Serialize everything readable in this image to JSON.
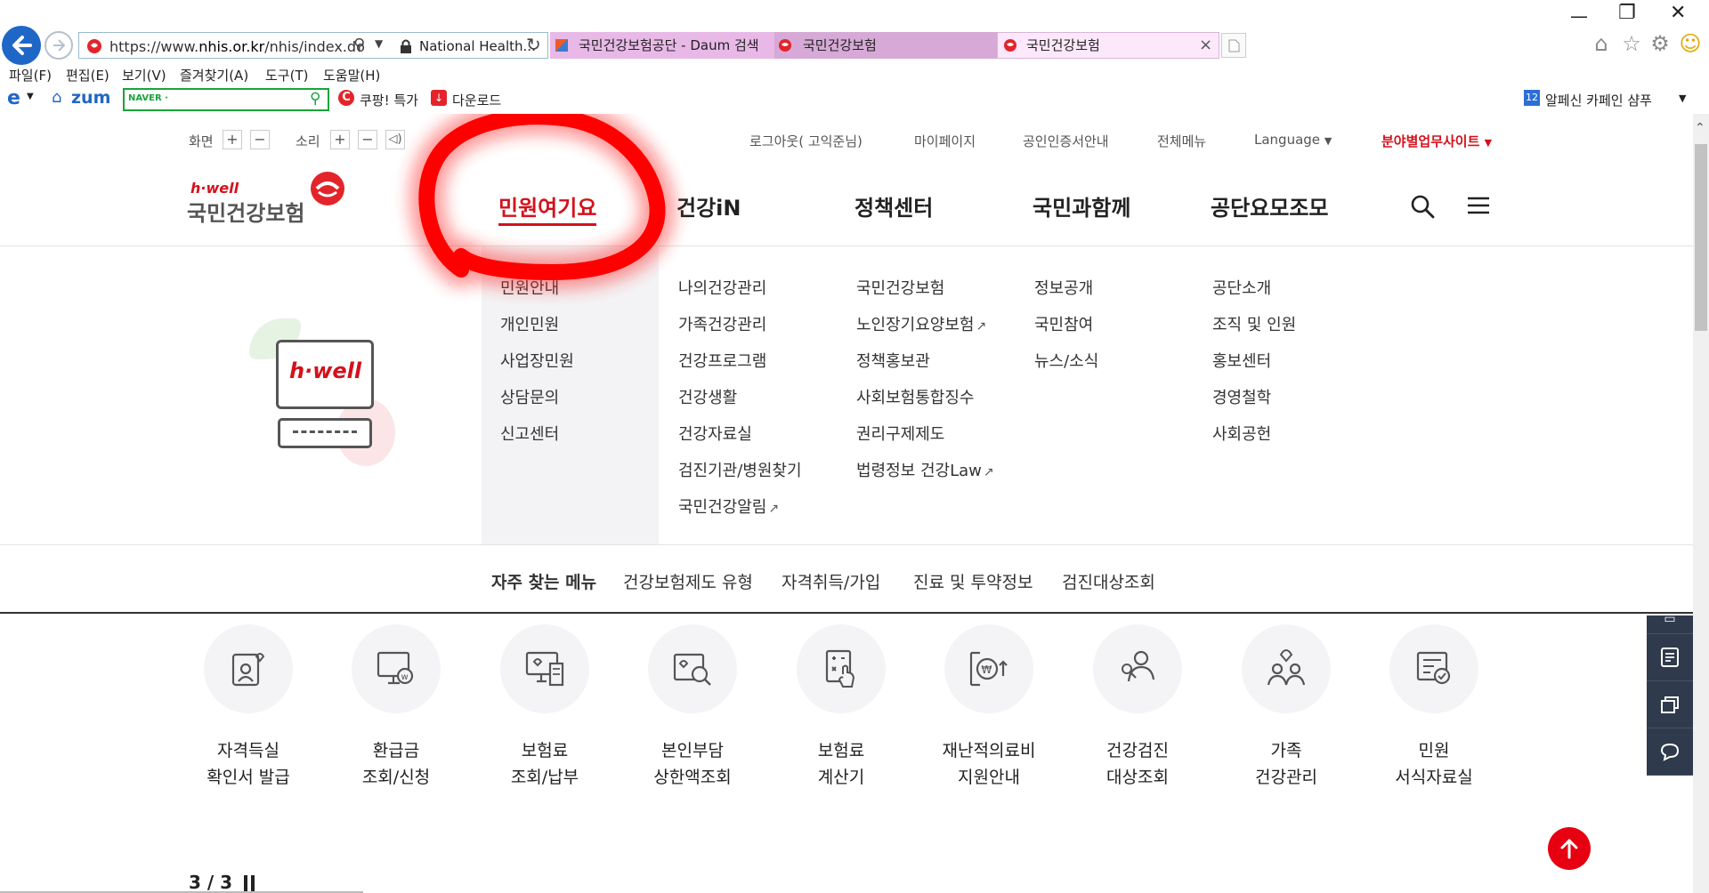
{
  "browser": {
    "url_prefix": "https://www.",
    "url_domain": "nhis.or.kr",
    "url_path": "/nhis/index.do",
    "site_identity": "National Health...",
    "tabs": [
      {
        "title": "국민건강보험공단 - Daum 검색"
      },
      {
        "title": "국민건강보험"
      },
      {
        "title": "국민건강보험",
        "close": "×"
      }
    ],
    "menu": [
      "파일(F)",
      "편집(E)",
      "보기(V)",
      "즐겨찾기(A)",
      "도구(T)",
      "도움말(H)"
    ],
    "favorites": {
      "zum": "zum",
      "naver_label": "NAVER ·",
      "coupang": "쿠팡! 특가",
      "download": "다운로드",
      "ad_badge": "12",
      "ad_text": "알페신 카페인 샴푸"
    }
  },
  "utility": {
    "screen_label": "화면",
    "sound_label": "소리",
    "plus": "+",
    "minus": "−",
    "logout": "로그아웃( 고익준님)",
    "mypage": "마이페이지",
    "cert": "공인인증서안내",
    "allmenu": "전체메뉴",
    "language": "Language",
    "biz_site": "분야별업무사이트"
  },
  "logo": {
    "script": "h·well",
    "name": "국민건강보험"
  },
  "gnb": [
    "민원여기요",
    "건강iN",
    "정책센터",
    "국민과함께",
    "공단요모조모"
  ],
  "submenu": {
    "col1": [
      "민원안내",
      "개인민원",
      "사업장민원",
      "상담문의",
      "신고센터"
    ],
    "col2": [
      "나의건강관리",
      "가족건강관리",
      "건강프로그램",
      "건강생활",
      "건강자료실",
      "검진기관/병원찾기",
      "국민건강알림"
    ],
    "col3": [
      "국민건강보험",
      "노인장기요양보험",
      "정책홍보관",
      "사회보험통합징수",
      "권리구제제도",
      "법령정보 건강Law"
    ],
    "col4": [
      "정보공개",
      "국민참여",
      "뉴스/소식"
    ],
    "col5": [
      "공단소개",
      "조직 및 인원",
      "홍보센터",
      "경영철학",
      "사회공헌"
    ]
  },
  "promo": {
    "brand": "h·well"
  },
  "quick_menu": {
    "title": "자주 찾는 메뉴",
    "items": [
      "건강보험제도 유형",
      "자격취득/가입",
      "진료 및 투약정보",
      "검진대상조회"
    ]
  },
  "services": [
    {
      "line1": "자격득실",
      "line2": "확인서 발급"
    },
    {
      "line1": "환급금",
      "line2": "조회/신청"
    },
    {
      "line1": "보험료",
      "line2": "조회/납부"
    },
    {
      "line1": "본인부담",
      "line2": "상한액조회"
    },
    {
      "line1": "보험료",
      "line2": "계산기"
    },
    {
      "line1": "재난적의료비",
      "line2": "지원안내"
    },
    {
      "line1": "건강검진",
      "line2": "대상조회"
    },
    {
      "line1": "가족",
      "line2": "건강관리"
    },
    {
      "line1": "민원",
      "line2": "서식자료실"
    }
  ],
  "pager": {
    "current": "3",
    "separator": "/",
    "total": "3"
  },
  "colors": {
    "accent": "#e60012",
    "gnb_active": "#d4111b",
    "side_panel": "#2f3a4c",
    "highlight": "#ff0000"
  }
}
